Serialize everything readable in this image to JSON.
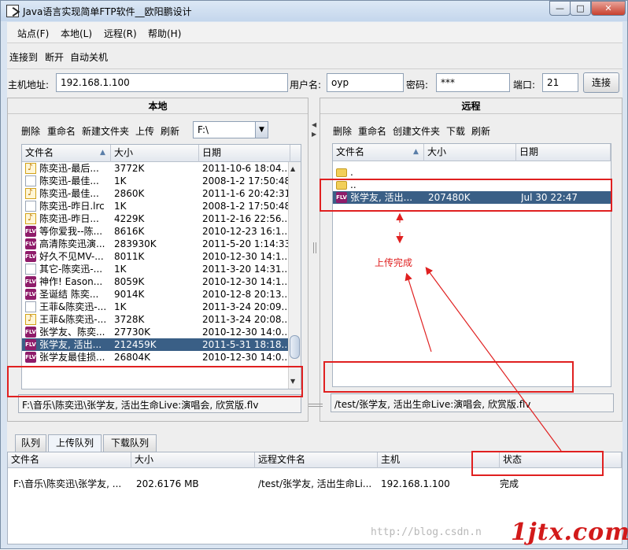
{
  "window": {
    "title": "Java语言实现简单FTP软件__欧阳鹏设计",
    "min": "—",
    "max": "□",
    "close": "✕"
  },
  "menu": [
    "站点(F)",
    "本地(L)",
    "远程(R)",
    "帮助(H)"
  ],
  "toolbar": [
    "连接到",
    "断开",
    "自动关机"
  ],
  "conn": {
    "host_label": "主机地址:",
    "host_value": "192.168.1.100",
    "user_label": "用户名:",
    "user_value": "oyp",
    "pass_label": "密码:",
    "pass_value": "***",
    "port_label": "端口:",
    "port_value": "21",
    "connect_label": "连接"
  },
  "local": {
    "title": "本地",
    "toolbar": [
      "删除",
      "重命名",
      "新建文件夹",
      "上传",
      "刷新"
    ],
    "drive": "F:\\",
    "columns": [
      "文件名",
      "大小",
      "日期"
    ],
    "rows": [
      {
        "icon": "music-icon",
        "name": "陈奕迅-最后...",
        "size": "3772K",
        "date": "2011-10-6 18:04..."
      },
      {
        "icon": "doc-icon",
        "name": "陈奕迅-最佳...",
        "size": "1K",
        "date": "2008-1-2 17:50:48"
      },
      {
        "icon": "music-icon",
        "name": "陈奕迅-最佳...",
        "size": "2860K",
        "date": "2011-1-6 20:42:31"
      },
      {
        "icon": "doc-icon",
        "name": "陈奕迅-昨日.lrc",
        "size": "1K",
        "date": "2008-1-2 17:50:48"
      },
      {
        "icon": "music-icon",
        "name": "陈奕迅-昨日...",
        "size": "4229K",
        "date": "2011-2-16 22:56..."
      },
      {
        "icon": "flv-icon",
        "name": "等你爱我--陈...",
        "size": "8616K",
        "date": "2010-12-23 16:1..."
      },
      {
        "icon": "flv-icon",
        "name": "高清陈奕迅演...",
        "size": "283930K",
        "date": "2011-5-20 1:14:33"
      },
      {
        "icon": "flv-icon",
        "name": "好久不见MV-...",
        "size": "8011K",
        "date": "2010-12-30 14:1..."
      },
      {
        "icon": "doc-icon",
        "name": "其它-陈奕迅-...",
        "size": "1K",
        "date": "2011-3-20 14:31..."
      },
      {
        "icon": "flv-icon",
        "name": "神作! Eason...",
        "size": "8059K",
        "date": "2010-12-30 14:1..."
      },
      {
        "icon": "flv-icon",
        "name": "圣诞结 陈奕...",
        "size": "9014K",
        "date": "2010-12-8 20:13..."
      },
      {
        "icon": "doc-icon",
        "name": "王菲&陈奕迅-...",
        "size": "1K",
        "date": "2011-3-24 20:09..."
      },
      {
        "icon": "music-icon",
        "name": "王菲&陈奕迅-...",
        "size": "3728K",
        "date": "2011-3-24 20:08..."
      },
      {
        "icon": "flv-icon",
        "name": "张学友、陈奕...",
        "size": "27730K",
        "date": "2010-12-30 14:0..."
      },
      {
        "icon": "flv-icon",
        "name": "张学友, 活出...",
        "size": "212459K",
        "date": "2011-5-31 18:18..."
      },
      {
        "icon": "flv-icon",
        "name": "张学友最佳损...",
        "size": "26804K",
        "date": "2010-12-30 14:0..."
      }
    ],
    "path": "F:\\音乐\\陈奕迅\\张学友, 活出生命Live:演唱会, 欣赏版.flv"
  },
  "remote": {
    "title": "远程",
    "toolbar": [
      "删除",
      "重命名",
      "创建文件夹",
      "下载",
      "刷新"
    ],
    "columns": [
      "文件名",
      "大小",
      "日期"
    ],
    "rows": [
      {
        "icon": "folder-icon",
        "name": ".",
        "size": "",
        "date": ""
      },
      {
        "icon": "folder-icon",
        "name": "..",
        "size": "",
        "date": ""
      },
      {
        "icon": "flv-icon",
        "name": "张学友, 活出...",
        "size": "207480K",
        "date": "Jul 30 22:47"
      }
    ],
    "path": "/test/张学友, 活出生命Live:演唱会, 欣赏版.flv"
  },
  "annotation": "上传完成",
  "tabs": [
    "队列",
    "上传队列",
    "下载队列"
  ],
  "queue": {
    "columns": [
      "文件名",
      "大小",
      "远程文件名",
      "主机",
      "状态"
    ],
    "rows": [
      {
        "file": "F:\\音乐\\陈奕迅\\张学友, ...",
        "size": "202.6176 MB",
        "remote": "/test/张学友, 活出生命Li...",
        "host": "192.168.1.100",
        "status": "完成"
      }
    ]
  },
  "watermark": "http://blog.csdn.n",
  "logo": "1jtx.com",
  "colors": {
    "selection": "#3a5f86",
    "annotation": "#e02020",
    "flv_icon": "#8f1c6a"
  }
}
